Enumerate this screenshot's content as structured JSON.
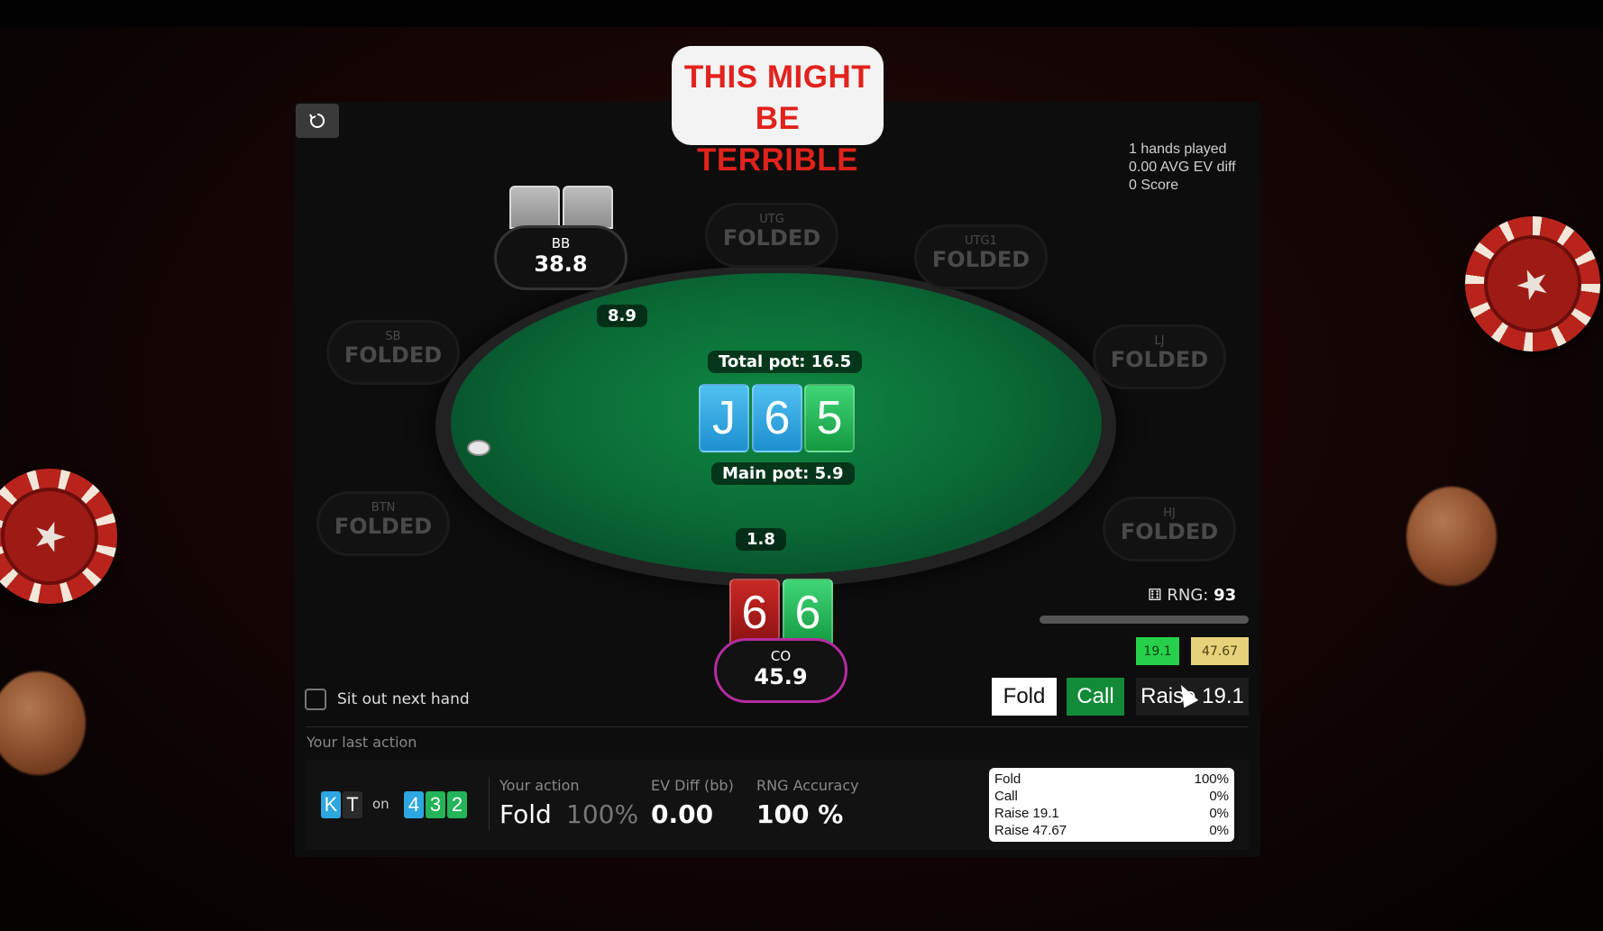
{
  "banner": {
    "line1": "THIS MIGHT",
    "line2": "BE TERRIBLE"
  },
  "stats": {
    "hands": "1 hands played",
    "ev": "0.00 AVG EV diff",
    "score": "0 Score"
  },
  "seats": {
    "bb": {
      "pos": "BB",
      "stack": "38.8"
    },
    "utg": {
      "pos": "UTG",
      "state": "FOLDED"
    },
    "utg1": {
      "pos": "UTG1",
      "state": "FOLDED"
    },
    "sb": {
      "pos": "SB",
      "state": "FOLDED"
    },
    "lj": {
      "pos": "LJ",
      "state": "FOLDED"
    },
    "btn": {
      "pos": "BTN",
      "state": "FOLDED"
    },
    "hj": {
      "pos": "HJ",
      "state": "FOLDED"
    },
    "co": {
      "pos": "CO",
      "stack": "45.9"
    }
  },
  "bets": {
    "bb_bet": "8.9",
    "co_bet": "1.8"
  },
  "pot": {
    "total": "Total pot: 16.5",
    "main": "Main pot: 5.9"
  },
  "board": [
    {
      "rank": "J",
      "suit": "diamond"
    },
    {
      "rank": "6",
      "suit": "diamond"
    },
    {
      "rank": "5",
      "suit": "club"
    }
  ],
  "hero_cards": [
    {
      "rank": "6",
      "suit": "heart"
    },
    {
      "rank": "6",
      "suit": "club"
    }
  ],
  "rng": {
    "label": "RNG:",
    "value": "93",
    "icon": "dice-icon"
  },
  "sizes": {
    "a": "19.1",
    "b": "47.67"
  },
  "actions": {
    "fold": "Fold",
    "call": "Call",
    "raise": "Raise 19.1"
  },
  "sitout": {
    "label": "Sit out next hand",
    "checked": false
  },
  "last": {
    "title": "Your last action",
    "hand": [
      "K",
      "T"
    ],
    "on": "on",
    "board": [
      "4",
      "3",
      "2"
    ],
    "your_action_label": "Your action",
    "your_action": "Fold",
    "your_action_pct": "100%",
    "ev_label": "EV Diff (bb)",
    "ev_value": "0.00",
    "rng_label": "RNG Accuracy",
    "rng_value": "100 %"
  },
  "freq": [
    {
      "action": "Fold",
      "pct": "100%"
    },
    {
      "action": "Call",
      "pct": "0%"
    },
    {
      "action": "Raise 19.1",
      "pct": "0%"
    },
    {
      "action": "Raise 47.67",
      "pct": "0%"
    }
  ],
  "colors": {
    "felt": "#0a6a35",
    "accent_green": "#26d04a",
    "accent_gold": "#e6d27a",
    "co_ring": "#b42c9f"
  }
}
